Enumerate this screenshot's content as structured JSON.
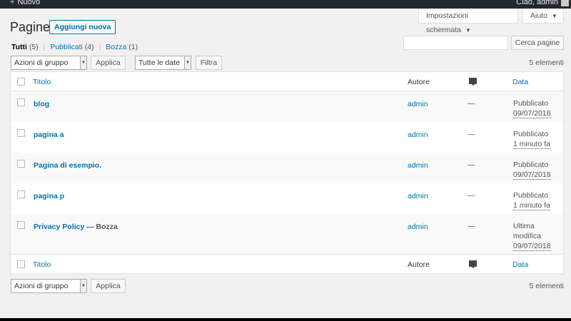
{
  "adminbar": {
    "new_label": "Nuovo",
    "plus": "+",
    "greeting": "Ciao, admin"
  },
  "screen_options": {
    "label": "Impostazioni schermata",
    "arrow": "▼"
  },
  "help": {
    "label": "Aiuto",
    "arrow": "▼"
  },
  "page_title": "Pagine",
  "add_new": "Aggiungi nuova",
  "filters": {
    "all": {
      "label": "Tutti",
      "count": "(5)"
    },
    "published": {
      "label": "Pubblicati",
      "count": "(4)"
    },
    "draft": {
      "label": "Bozza",
      "count": "(1)"
    },
    "separator": "|"
  },
  "search": {
    "value": "",
    "button": "Cerca pagine"
  },
  "bulk_top": {
    "selected": "Azioni di gruppo",
    "apply": "Applica"
  },
  "date_filter": {
    "selected": "Tutte le date",
    "button": "Filtra"
  },
  "items_count": "5 elementi",
  "columns": {
    "title": "Titolo",
    "author": "Autore",
    "date": "Data"
  },
  "rows": [
    {
      "title": "blog",
      "state": "",
      "author": "admin",
      "comments": "—",
      "date_status": "Pubblicato",
      "date_extra": "",
      "date_value": "09/07/2018"
    },
    {
      "title": "pagina a",
      "state": "",
      "author": "admin",
      "comments": "—",
      "date_status": "Pubblicato",
      "date_extra": "",
      "date_value": "1 minuto fa"
    },
    {
      "title": "Pagina di esempio.",
      "state": "",
      "author": "admin",
      "comments": "—",
      "date_status": "Pubblicato",
      "date_extra": "",
      "date_value": "09/07/2018"
    },
    {
      "title": "pagina p",
      "state": "",
      "author": "admin",
      "comments": "—",
      "date_status": "Pubblicato",
      "date_extra": "",
      "date_value": "1 minuto fa"
    },
    {
      "title": "Privacy Policy",
      "state": " — Bozza",
      "author": "admin",
      "comments": "—",
      "date_status": "Ultima",
      "date_extra": "modifica",
      "date_value": "09/07/2018"
    }
  ],
  "bulk_bottom": {
    "selected": "Azioni di gruppo",
    "apply": "Applica"
  },
  "colors": {
    "link": "#0073aa",
    "adminbar": "#23282d",
    "background": "#f1f1f1"
  }
}
